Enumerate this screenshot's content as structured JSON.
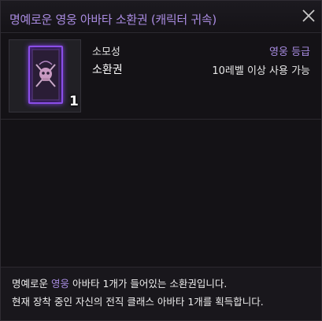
{
  "tooltip": {
    "title": "명예로운 영웅 아바타 소환권 (캐릭터 귀속)",
    "item": {
      "category": "소모성",
      "grade": "영웅 등급",
      "type": "소환권",
      "requirement": "10레벨 이상 사용 가능",
      "quantity": "1",
      "icon": "avatar-summon-card-icon"
    },
    "description": {
      "line1_prefix": "명예로운 ",
      "line1_highlight": "영웅",
      "line1_suffix": " 아바타 1개가 들어있는 소환권입니다.",
      "line2": "현재 장착 중인 자신의 전직 클래스 아바타 1개를 획득합니다."
    }
  },
  "colors": {
    "title": "#a98be0",
    "grade": "#a78be0",
    "card_border": "#8a4ee8",
    "background": "#141216"
  }
}
